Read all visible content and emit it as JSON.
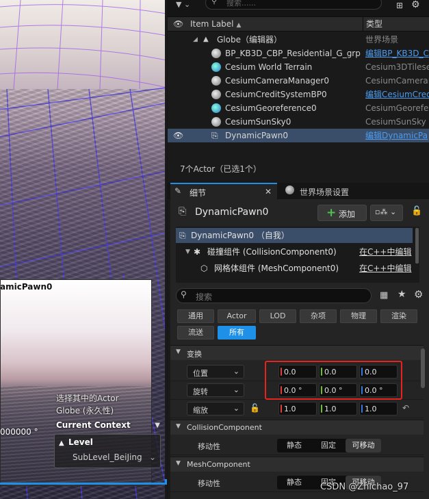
{
  "viewport": {
    "preview_actor_name": "amicPawn0",
    "preview_coord": "000000 °",
    "context_lines": [
      "选择其中的Actor",
      "Globe (永久性)"
    ],
    "current_context_label": "Current Context",
    "level_label": "Level",
    "sublevel": "SubLevel_BeiJing"
  },
  "outliner": {
    "search_placeholder": "搜索......",
    "col_label": "Item Label",
    "col_type": "类型",
    "rows": [
      {
        "label": "Globe（编辑器）",
        "type": "世界场景",
        "type_link": false,
        "selected": false
      },
      {
        "label": "BP_KB3D_CBP_Residential_G_grp",
        "type": "编辑BP_KB3D_C",
        "type_link": true,
        "selected": false
      },
      {
        "label": "Cesium World Terrain",
        "type": "Cesium3DTilese",
        "type_link": false,
        "selected": false
      },
      {
        "label": "CesiumCameraManager0",
        "type": "CesiumCameraM",
        "type_link": false,
        "selected": false
      },
      {
        "label": "CesiumCreditSystemBP0",
        "type": "编辑CesiumCred",
        "type_link": true,
        "selected": false
      },
      {
        "label": "CesiumGeoreference0",
        "type": "CesiumGeorefer",
        "type_link": false,
        "selected": false
      },
      {
        "label": "CesiumSunSky0",
        "type": "CesiumSunSky",
        "type_link": false,
        "selected": false
      },
      {
        "label": "DynamicPawn0",
        "type": "编辑DynamicPa",
        "type_link": true,
        "selected": true
      }
    ],
    "status": "7个Actor（已选1个）"
  },
  "details": {
    "tab_details": "细节",
    "tab_world": "世界场景设置",
    "actor_name": "DynamicPawn0",
    "add_label": "添加",
    "tree": {
      "self_label": "DynamicPawn0 （自我）",
      "collision_label": "碰撞组件 (CollisionComponent0)",
      "mesh_label": "网格体组件 (MeshComponent0)",
      "edit_cpp": "在C++中编辑"
    },
    "search_placeholder": "搜索",
    "filters": [
      "通用",
      "Actor",
      "LOD",
      "杂项",
      "物理",
      "渲染",
      "流送",
      "所有"
    ],
    "section_transform": "变换",
    "location_label": "位置",
    "location": [
      "0.0",
      "0.0",
      "0.0"
    ],
    "rotation_label": "旋转",
    "rotation": [
      "0.0 °",
      "0.0 °",
      "0.0 °"
    ],
    "scale_label": "缩放",
    "scale": [
      "1.0",
      "1.0",
      "1.0"
    ],
    "section_collision": "CollisionComponent",
    "section_mesh": "MeshComponent",
    "mobility_label": "移动性",
    "mobility_options": [
      "静态",
      "固定",
      "可移动"
    ],
    "mobility_selected": "可移动"
  },
  "watermark": "CSDN @Zhichao_97",
  "colors": {
    "accent": "#1e90e8",
    "selection": "#3b4e69",
    "highlight": "#e5251d",
    "axis_x": "#e04040",
    "axis_y": "#6fbf2a",
    "axis_z": "#3a78e0"
  }
}
